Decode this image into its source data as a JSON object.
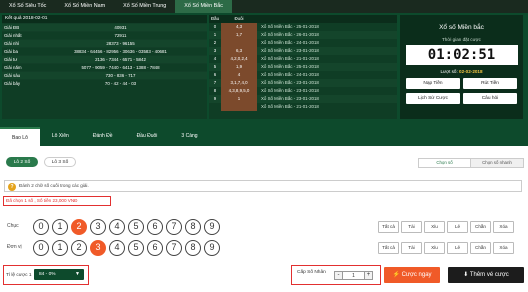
{
  "topnav": {
    "tabs": [
      "Xổ Số Siêu Tốc",
      "Xổ Số Miền Nam",
      "Xổ Số Miền Trung",
      "Xổ Số Miền Bắc"
    ],
    "active_index": 3
  },
  "results": {
    "header": "Kết quả 2018-02-01",
    "rows": [
      {
        "label": "Giải ĐB",
        "value": "40931"
      },
      {
        "label": "Giải nhất",
        "value": "72911"
      },
      {
        "label": "Giải nhì",
        "value": "28373 - 96155"
      },
      {
        "label": "Giải ba",
        "value": "38834 - 64456 - 82956 - 30636 - 03583 - 40681"
      },
      {
        "label": "Giải tư",
        "value": "2136 - 7344 - 6571 - 5842"
      },
      {
        "label": "Giải năm",
        "value": "5077 - 9059 - 7440 - 6413 - 1388 - 7848"
      },
      {
        "label": "Giải sáu",
        "value": "730 - 836 - 717"
      },
      {
        "label": "Giải bảy",
        "value": "70 - 42 - 44 - 03"
      }
    ]
  },
  "head_tail": {
    "headers": [
      "Đầu",
      "Đuôi"
    ],
    "rows": [
      {
        "d": "0",
        "v": "4,3"
      },
      {
        "d": "1",
        "v": "1,7"
      },
      {
        "d": "2",
        "v": ""
      },
      {
        "d": "3",
        "v": "6,3"
      },
      {
        "d": "4",
        "v": "4,2,0,2,4"
      },
      {
        "d": "5",
        "v": "1,9"
      },
      {
        "d": "6",
        "v": "4"
      },
      {
        "d": "7",
        "v": "3,1,7,4,0"
      },
      {
        "d": "8",
        "v": "4,3,8,9,5,0"
      },
      {
        "d": "9",
        "v": "1"
      }
    ],
    "list": [
      "Xổ Số Miền Bắc - 25-01-2018",
      "Xổ Số Miền Bắc - 26-01-2018",
      "Xổ Số Miền Bắc - 24-01-2018",
      "Xổ Số Miền Bắc - 23-01-2018",
      "Xổ Số Miền Bắc - 21-01-2018",
      "Xổ Số Miền Bắc - 25-01-2018",
      "Xổ Số Miền Bắc - 24-01-2018",
      "Xổ Số Miền Bắc - 23-01-2018",
      "Xổ Số Miền Bắc - 23-01-2018",
      "Xổ Số Miền Bắc - 23-01-2018",
      "Xổ Số Miền Bắc - 21-01-2018"
    ]
  },
  "panel": {
    "title": "Xổ số Miền bắc",
    "time_label": "Thời gian đặt cược",
    "timer": "01:02:51",
    "draw_label": "Lượt số",
    "draw_date": "02-02-2018",
    "deposit": "Nạp Tiền",
    "withdraw": "Rút Tiền",
    "history": "Lịch Sử Cược",
    "help": "Câu hỏi"
  },
  "game_tabs": [
    "Bao Lô",
    "Lô Xiên",
    "Đánh Đề",
    "Đầu Đuôi",
    "3 Càng"
  ],
  "sub_tabs": [
    "Lô 2 Số",
    "Lô 3 Số"
  ],
  "mode": {
    "pick": "Chọn số",
    "quick": "Chọn số nhanh"
  },
  "hint": "Đánh 2 chữ số cuối trong các giải.",
  "selected_info": "Đã chọn 1 số , Số tiền 23,000 VNĐ",
  "rows": [
    {
      "label": "Chục",
      "selected": [
        2
      ]
    },
    {
      "label": "Đơn vị",
      "selected": [
        3
      ]
    }
  ],
  "digits": [
    "0",
    "1",
    "2",
    "3",
    "4",
    "5",
    "6",
    "7",
    "8",
    "9"
  ],
  "quick_btns": [
    "Tất cả",
    "Tài",
    "Xỉu",
    "Lẻ",
    "Chẵn",
    "Xóa"
  ],
  "rate": {
    "label": "Tỉ lệ cược 1",
    "value": "84 - 0%"
  },
  "multiplier": {
    "label": "Cấp Số Nhân",
    "value": "1"
  },
  "bet_label": "Cược ngay",
  "add_label": "Thêm vé cược",
  "colors": {
    "dark_green": "#0d4a2c",
    "orange": "#f05a28",
    "red": "#e23030"
  }
}
